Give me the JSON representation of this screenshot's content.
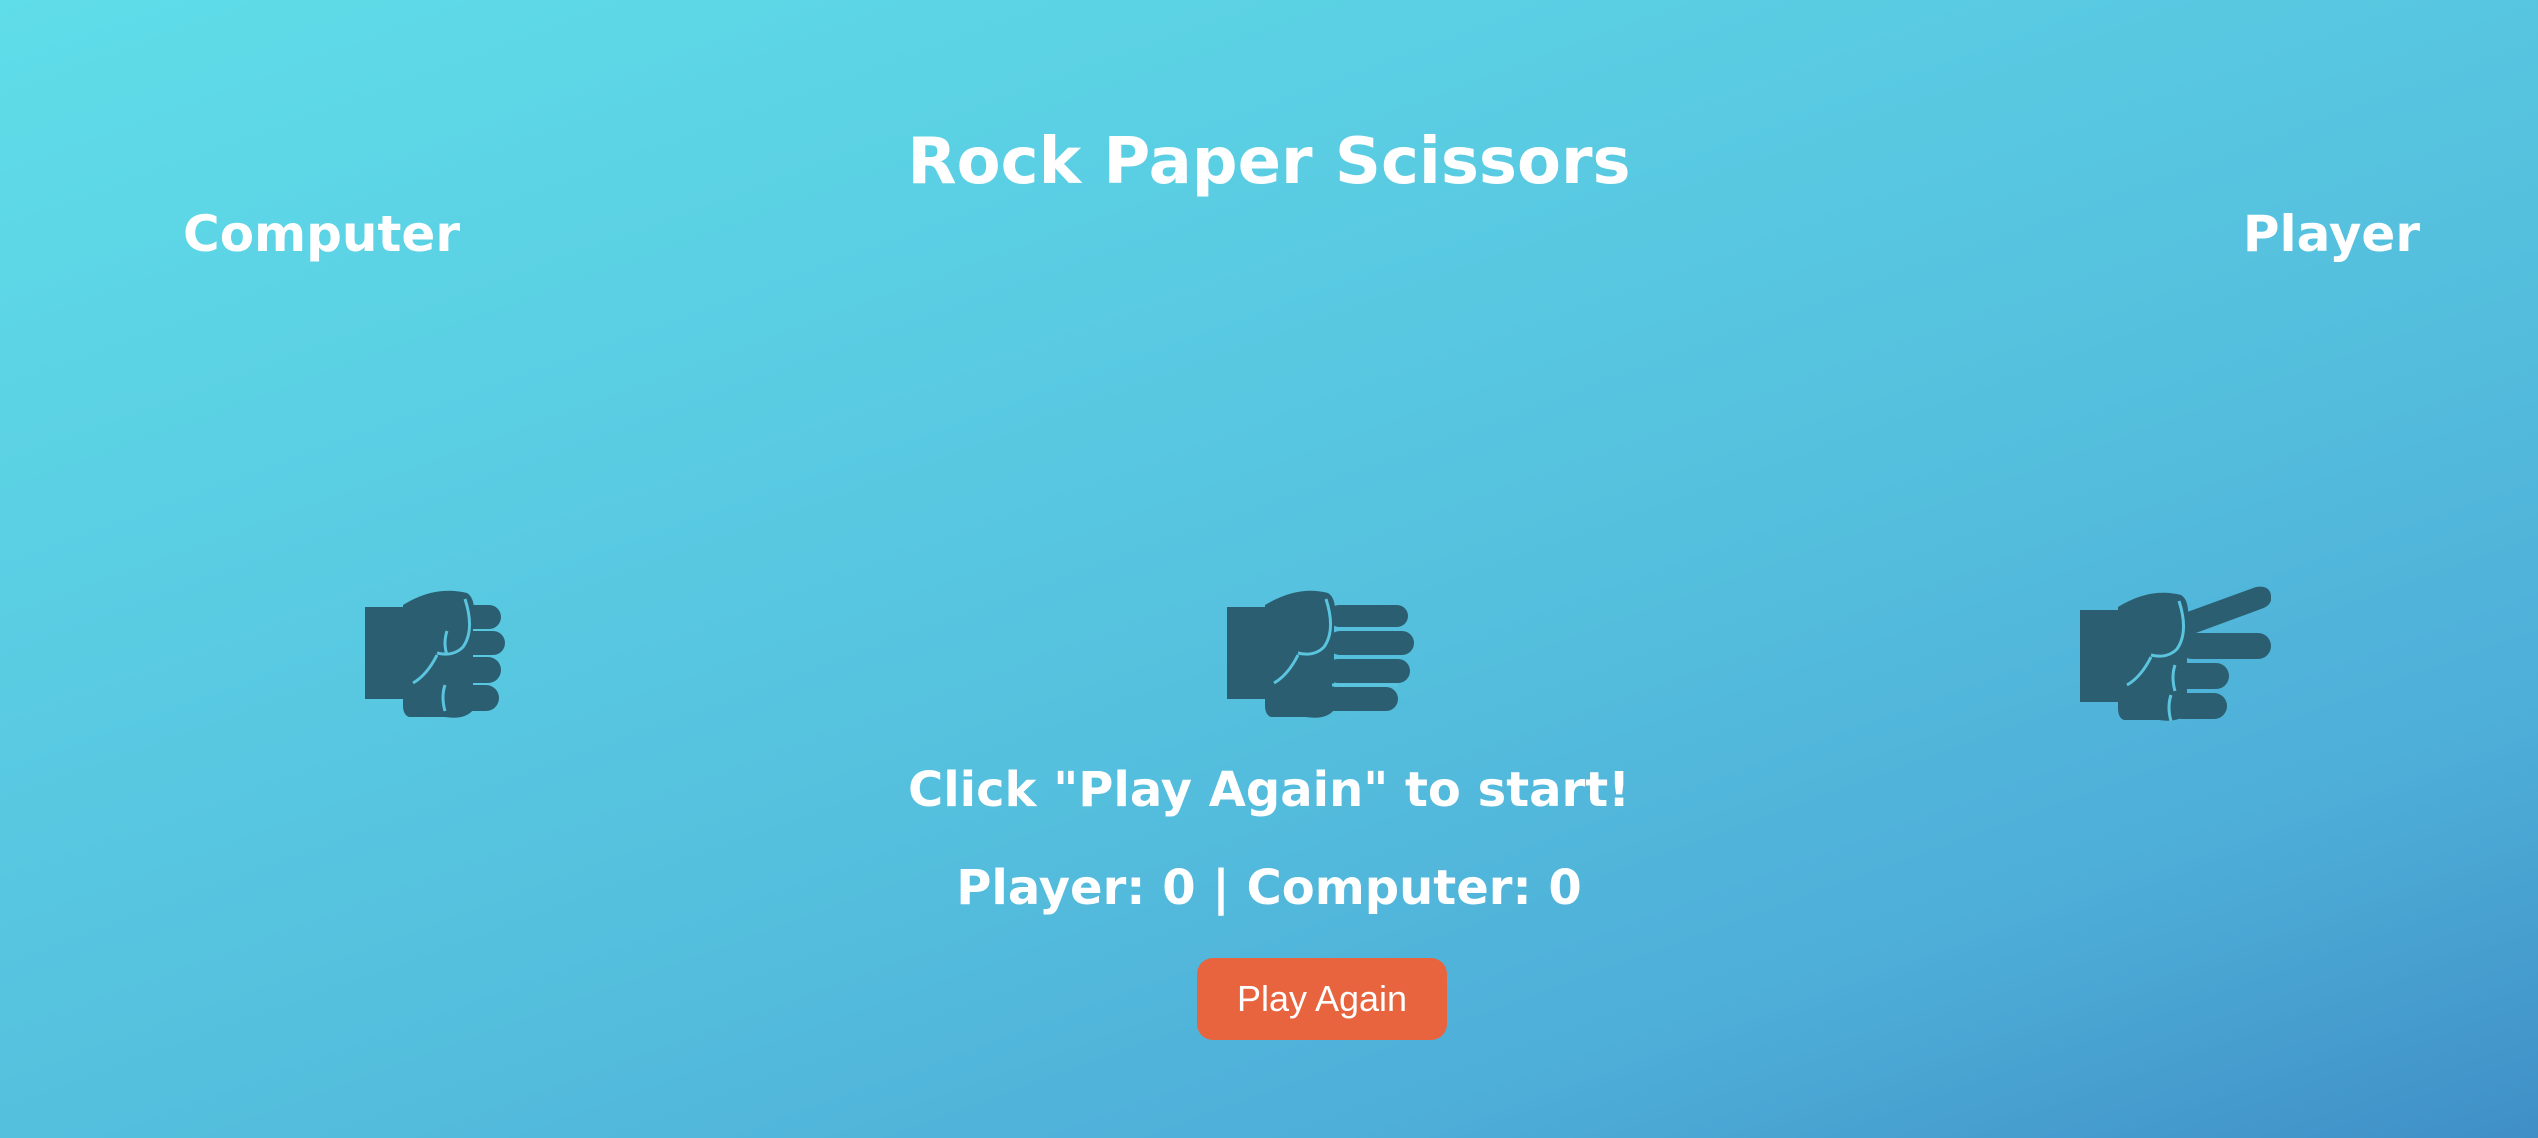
{
  "game": {
    "title": "Rock Paper Scissors",
    "computer_label": "Computer",
    "player_label": "Player",
    "choices": [
      {
        "name": "rock",
        "icon": "rock-hand-icon"
      },
      {
        "name": "paper",
        "icon": "paper-hand-icon"
      },
      {
        "name": "scissors",
        "icon": "scissors-hand-icon"
      }
    ],
    "status_message": "Click \"Play Again\" to start!",
    "score_text": "Player: 0 | Computer: 0",
    "play_again_label": "Play Again"
  },
  "colors": {
    "background_top": "#5fdde8",
    "background_bottom": "#3f8fc6",
    "hand_icon": "#2b5e70",
    "button": "#e8643f",
    "text": "#ffffff"
  }
}
